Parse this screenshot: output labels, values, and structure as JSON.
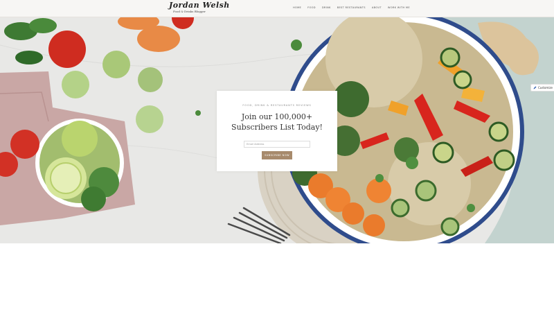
{
  "header": {
    "logo_script": "Jordan Welsh",
    "logo_tagline": "Food & Drinks Blogger",
    "nav": [
      "HOME",
      "FOOD",
      "DRINK",
      "BEST RESTAURANTS",
      "ABOUT",
      "WORK WITH ME"
    ]
  },
  "modal": {
    "eyebrow": "FOOD, DRINK & RESTAURANTS REVIEWS",
    "headline": "Join our 100,000+ Subscribers List Today!",
    "email_placeholder": "Email Address",
    "subscribe_label": "SUBSCRIBE NOW"
  },
  "customize": {
    "label": "Customize",
    "icon": "pencil-icon"
  }
}
